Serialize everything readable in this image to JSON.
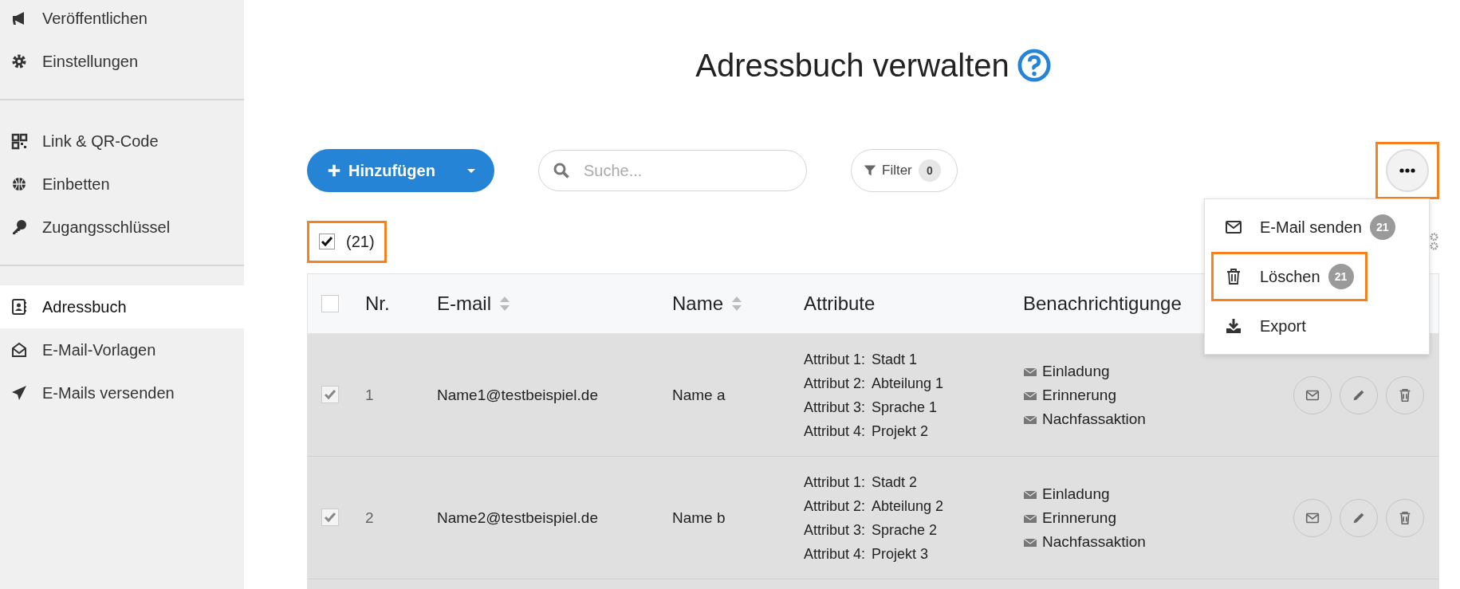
{
  "sidebar": {
    "groups": [
      {
        "items": [
          {
            "label": "Veröffentlichen",
            "selected": false
          },
          {
            "label": "Einstellungen",
            "selected": false
          }
        ]
      },
      {
        "items": [
          {
            "label": "Link & QR-Code",
            "selected": false
          },
          {
            "label": "Einbetten",
            "selected": false
          },
          {
            "label": "Zugangsschlüssel",
            "selected": false
          }
        ]
      },
      {
        "items": [
          {
            "label": "Adressbuch",
            "selected": true
          },
          {
            "label": "E-Mail-Vorlagen",
            "selected": false
          },
          {
            "label": "E-Mails versenden",
            "selected": false
          }
        ]
      }
    ]
  },
  "title": "Adressbuch verwalten",
  "toolbar": {
    "add_button": {
      "label": "Hinzufügen"
    },
    "search": {
      "placeholder": "Suche..."
    },
    "filter": {
      "label": "Filter",
      "count": "0"
    },
    "more_button": {
      "highlighted": true
    }
  },
  "select_all": {
    "checked": true,
    "count": "(21)",
    "highlighted": true
  },
  "menu": {
    "items": [
      {
        "label": "E-Mail senden",
        "badge": "21",
        "highlighted": false
      },
      {
        "label": "Löschen",
        "badge": "21",
        "highlighted": true
      },
      {
        "label": "Export",
        "highlighted": false
      }
    ]
  },
  "table": {
    "header_checked": false,
    "columns": [
      {
        "label": "Nr.",
        "sortable": false
      },
      {
        "label": "E-mail",
        "sortable": true
      },
      {
        "label": "Name",
        "sortable": true
      },
      {
        "label": "Attribute",
        "sortable": false
      },
      {
        "label": "Benachrichtigunge",
        "sortable": false
      }
    ],
    "rows": [
      {
        "checked": true,
        "nr": "1",
        "email": "Name1@testbeispiel.de",
        "name": "Name a",
        "attributes": [
          {
            "label": "Attribut 1:",
            "value": "Stadt 1"
          },
          {
            "label": "Attribut 2:",
            "value": "Abteilung 1"
          },
          {
            "label": "Attribut 3:",
            "value": "Sprache 1"
          },
          {
            "label": "Attribut 4:",
            "value": "Projekt 2"
          }
        ],
        "notifications": [
          "Einladung",
          "Erinnerung",
          "Nachfassaktion"
        ]
      },
      {
        "checked": true,
        "nr": "2",
        "email": "Name2@testbeispiel.de",
        "name": "Name b",
        "attributes": [
          {
            "label": "Attribut 1:",
            "value": "Stadt 2"
          },
          {
            "label": "Attribut 2:",
            "value": "Abteilung 2"
          },
          {
            "label": "Attribut 3:",
            "value": "Sprache 2"
          },
          {
            "label": "Attribut 4:",
            "value": "Projekt 3"
          }
        ],
        "notifications": [
          "Einladung",
          "Erinnerung",
          "Nachfassaktion"
        ]
      }
    ]
  }
}
